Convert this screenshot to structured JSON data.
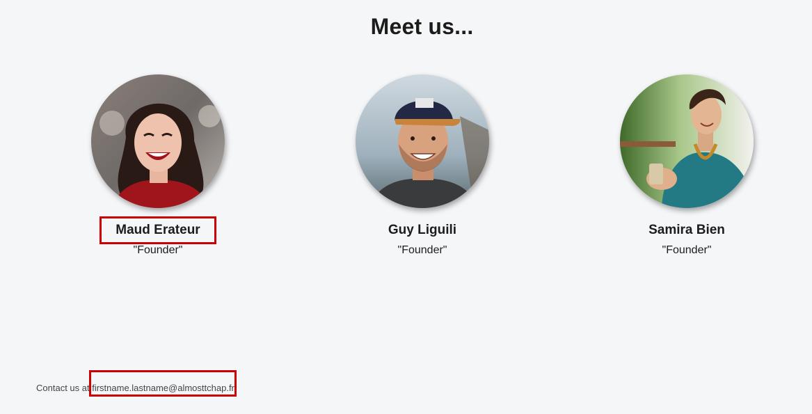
{
  "page": {
    "title": "Meet us..."
  },
  "members": [
    {
      "name": "Maud Erateur",
      "role": "\"Founder\""
    },
    {
      "name": "Guy Liguili",
      "role": "\"Founder\""
    },
    {
      "name": "Samira Bien",
      "role": "\"Founder\""
    }
  ],
  "footer": {
    "prefix": "Contact us at ",
    "email": "firstname.lastname@almosttchap.fr"
  },
  "colors": {
    "background": "#f5f6f8",
    "highlight": "#cc0000",
    "text": "#1c1c1c"
  },
  "icons": {
    "member_0": "portrait-photo",
    "member_1": "portrait-photo",
    "member_2": "portrait-photo"
  }
}
